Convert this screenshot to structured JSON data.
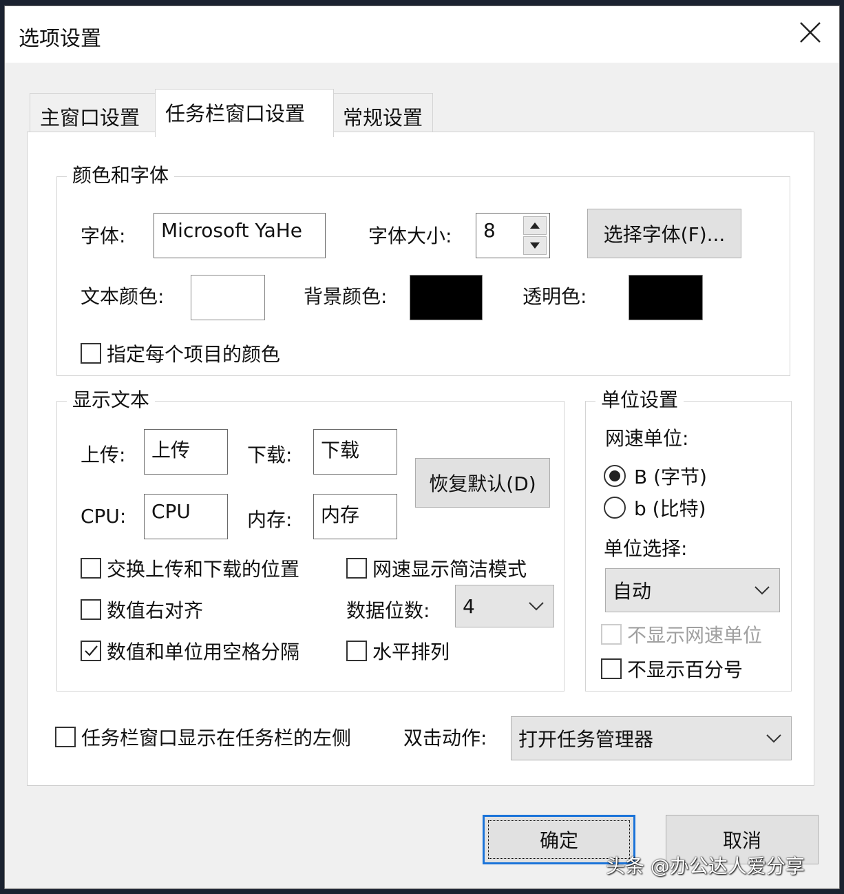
{
  "window": {
    "title": "选项设置",
    "close_icon": "close-icon"
  },
  "tabs": [
    {
      "label": "主窗口设置",
      "active": false
    },
    {
      "label": "任务栏窗口设置",
      "active": true
    },
    {
      "label": "常规设置",
      "active": false
    }
  ],
  "color_font": {
    "title": "颜色和字体",
    "font_label": "字体:",
    "font_value": "Microsoft YaHe",
    "font_size_label": "字体大小:",
    "font_size_value": "8",
    "choose_font_button": "选择字体(F)...",
    "text_color_label": "文本颜色:",
    "text_color": "#ffffff",
    "bg_color_label": "背景颜色:",
    "bg_color": "#000000",
    "transparent_color_label": "透明色:",
    "transparent_color": "#000000",
    "per_item_color_label": "指定每个项目的颜色",
    "per_item_color_checked": false
  },
  "display_text": {
    "title": "显示文本",
    "upload_label": "上传:",
    "upload_value": "上传",
    "download_label": "下载:",
    "download_value": "下载",
    "cpu_label": "CPU:",
    "cpu_value": "CPU",
    "memory_label": "内存:",
    "memory_value": "内存",
    "restore_default_button": "恢复默认(D)",
    "swap_updown_label": "交换上传和下载的位置",
    "swap_updown_checked": false,
    "speed_compact_label": "网速显示简洁模式",
    "speed_compact_checked": false,
    "right_align_label": "数值右对齐",
    "right_align_checked": false,
    "digits_label": "数据位数:",
    "digits_value": "4",
    "space_separate_label": "数值和单位用空格分隔",
    "space_separate_checked": true,
    "horizontal_label": "水平排列",
    "horizontal_checked": false
  },
  "unit_settings": {
    "title": "单位设置",
    "speed_unit_label": "网速单位:",
    "radio_byte_label": "B (字节)",
    "radio_byte_selected": true,
    "radio_bit_label": "b (比特)",
    "radio_bit_selected": false,
    "unit_select_label": "单位选择:",
    "unit_select_value": "自动",
    "hide_speed_unit_label": "不显示网速单位",
    "hide_speed_unit_checked": false,
    "hide_speed_unit_disabled": true,
    "hide_percent_label": "不显示百分号",
    "hide_percent_checked": false
  },
  "bottom": {
    "show_left_label": "任务栏窗口显示在任务栏的左侧",
    "show_left_checked": false,
    "double_click_label": "双击动作:",
    "double_click_value": "打开任务管理器"
  },
  "buttons": {
    "ok": "确定",
    "cancel": "取消"
  },
  "watermark": "头条 @办公达人爱分享"
}
